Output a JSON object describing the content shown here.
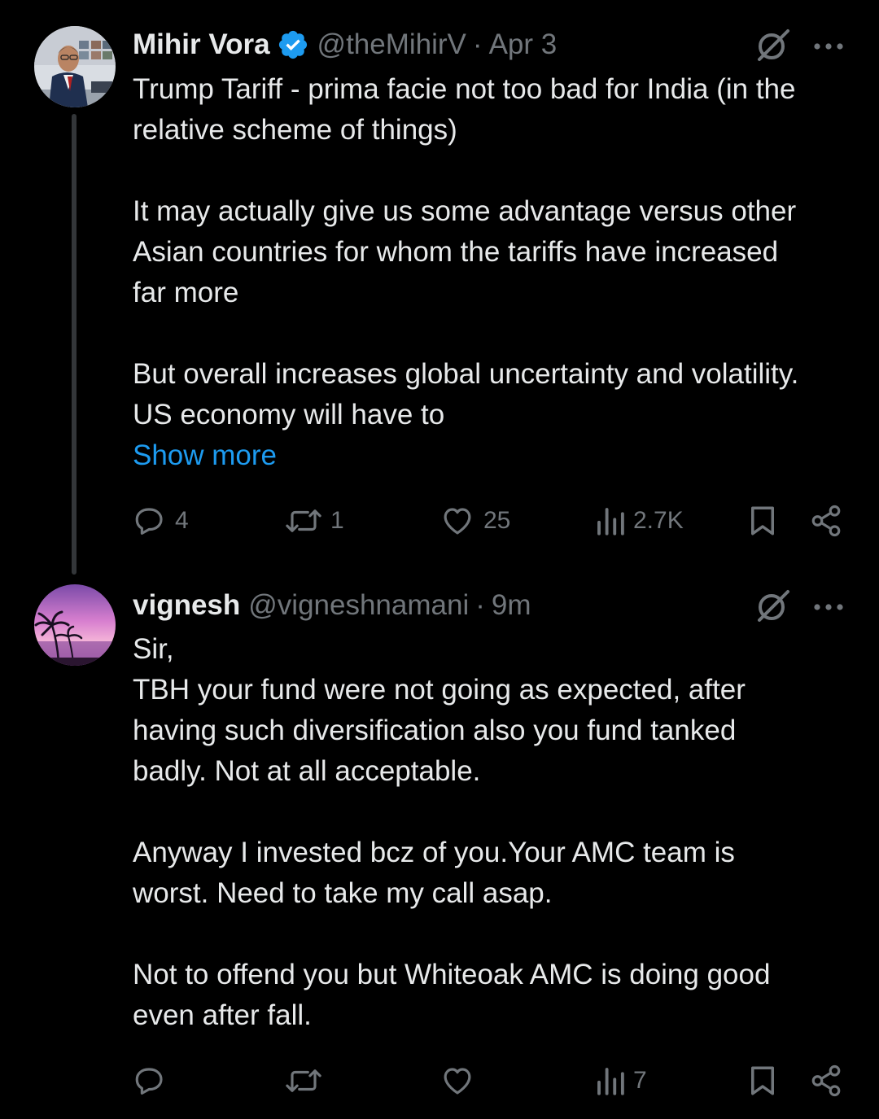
{
  "tweets": [
    {
      "name": "Mihir Vora",
      "verified": true,
      "handle": "@theMihirV",
      "separator": "·",
      "time": "Apr 3",
      "body_lines": [
        "Trump Tariff - prima facie not too bad for India (in the",
        "relative scheme of things)",
        "",
        "It may actually give us some advantage versus other",
        "Asian countries for whom the tariffs have increased",
        "far more",
        "",
        "But overall increases global uncertainty and volatility.",
        "US economy will have to"
      ],
      "show_more": "Show more",
      "actions": {
        "replies": "4",
        "reposts": "1",
        "likes": "25",
        "views": "2.7K"
      }
    },
    {
      "name": "vignesh",
      "verified": false,
      "handle": "@vigneshnamani",
      "separator": "·",
      "time": "9m",
      "body_lines": [
        "Sir,",
        "TBH your fund were not going as expected, after",
        "having such diversification also you fund tanked",
        "badly. Not at all acceptable.",
        "",
        "Anyway I invested bcz of you.Your AMC team is",
        "worst. Need to take my call asap.",
        "",
        "Not to offend you but Whiteoak AMC is doing good",
        "even after fall."
      ],
      "actions": {
        "replies": "",
        "reposts": "",
        "likes": "",
        "views": "7"
      }
    }
  ],
  "colors": {
    "background": "#000000",
    "text": "#e7e9ea",
    "muted": "#71767b",
    "link": "#1d9bf0",
    "verified": "#1d9bf0"
  }
}
